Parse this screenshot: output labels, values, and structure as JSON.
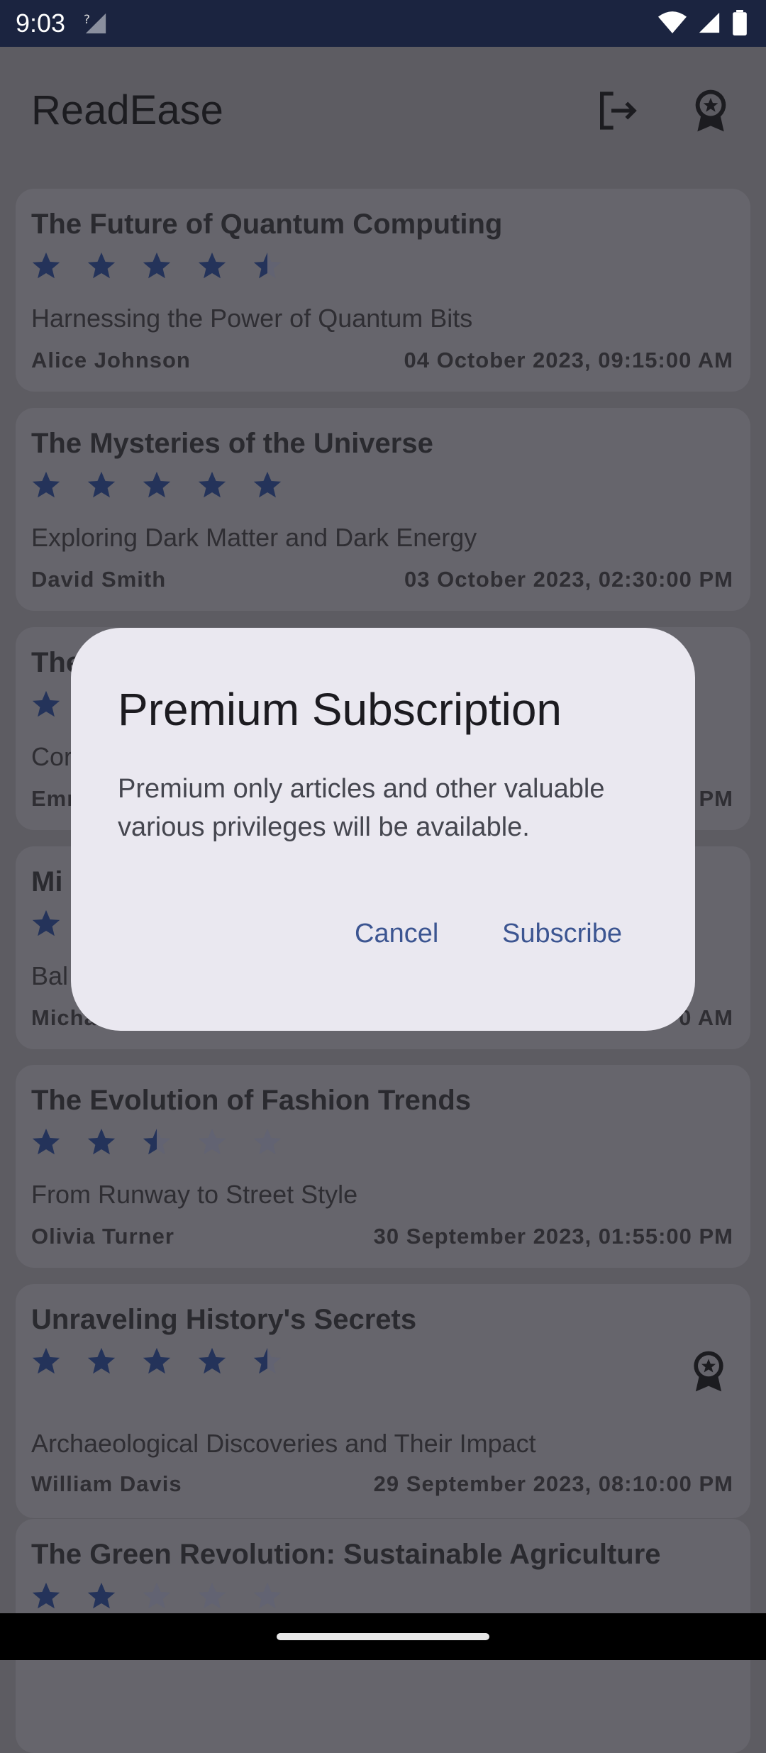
{
  "status_bar": {
    "time": "9:03"
  },
  "app": {
    "title": "ReadEase"
  },
  "colors": {
    "star": "#24335a",
    "star_empty": "#5e6178",
    "accent": "#3c5591",
    "status_bar": "#1b2440"
  },
  "articles": [
    {
      "title": "The Future of Quantum Computing",
      "rating": 4.5,
      "subtitle": "Harnessing the Power of Quantum Bits",
      "author": "Alice Johnson",
      "date": "04 October 2023, 09:15:00 AM",
      "premium": false
    },
    {
      "title": "The Mysteries of the Universe",
      "rating": 5,
      "subtitle": "Exploring Dark Matter and Dark Energy",
      "author": "David Smith",
      "date": "03 October 2023, 02:30:00 PM",
      "premium": false
    },
    {
      "title": "The",
      "rating": 1,
      "subtitle": "Cor",
      "author": "Emr",
      "date": "PM",
      "premium": false
    },
    {
      "title": "Mi",
      "rating": 1,
      "subtitle": "Bal",
      "author": "Micha",
      "date": "0 AM",
      "premium": false
    },
    {
      "title": "The Evolution of Fashion Trends",
      "rating": 2.5,
      "subtitle": "From Runway to Street Style",
      "author": "Olivia Turner",
      "date": "30 September 2023, 01:55:00 PM",
      "premium": false
    },
    {
      "title": "Unraveling History's Secrets",
      "rating": 4.5,
      "subtitle": "Archaeological Discoveries and Their Impact",
      "author": "William Davis",
      "date": "29 September 2023, 08:10:00 PM",
      "premium": true
    },
    {
      "title": "The Green Revolution: Sustainable Agriculture",
      "rating": 2,
      "subtitle": "",
      "author": "",
      "date": "",
      "premium": false
    }
  ],
  "dialog": {
    "title": "Premium Subscription",
    "body": "Premium only articles and other valuable various privileges will be available.",
    "cancel_label": "Cancel",
    "subscribe_label": "Subscribe"
  }
}
